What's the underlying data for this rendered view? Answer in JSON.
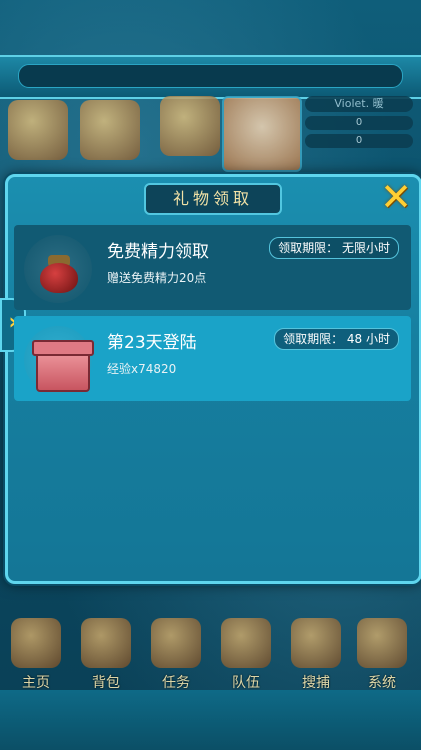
{
  "hud": {
    "player_name": "Violet. 暖",
    "stat1": "0",
    "stat2": "0"
  },
  "modal": {
    "title": "礼物领取",
    "close_icon": "close-x-icon",
    "gifts": [
      {
        "title": "免费精力领取",
        "desc": "赠送免费精力20点",
        "deadline": "领取期限： 无限小时",
        "icon": "red-jar-icon"
      },
      {
        "title": "第23天登陆",
        "desc": "经验x74820",
        "deadline": "领取期限： 48  小时",
        "icon": "red-giftbox-icon"
      }
    ]
  },
  "bottom_menu": [
    {
      "label": "主页",
      "icon": "home-icon"
    },
    {
      "label": "背包",
      "icon": "backpack-icon"
    },
    {
      "label": "任务",
      "icon": "scroll-icon"
    },
    {
      "label": "队伍",
      "icon": "team-icon"
    },
    {
      "label": "搜捕",
      "icon": "capture-icon"
    },
    {
      "label": "系统",
      "icon": "gear-icon"
    }
  ],
  "colors": {
    "panel": "#1b8fb0",
    "panel_border": "#5fd6ee",
    "selected_row": "#1aa3c8",
    "accent_gold": "#ffcf33"
  }
}
